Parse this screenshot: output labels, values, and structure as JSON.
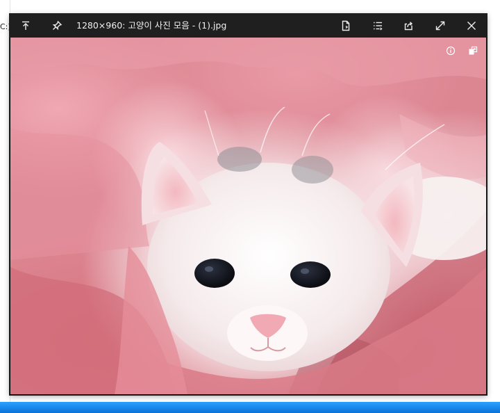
{
  "background": {
    "drive_fragment": "C:)"
  },
  "viewer": {
    "title": "1280×960: 고양이 사진 모음 - (1).jpg",
    "toolbar_left": [
      {
        "icon": "scroll-to-top-icon"
      },
      {
        "icon": "pin-icon"
      }
    ],
    "toolbar_right": [
      {
        "icon": "open-file-icon"
      },
      {
        "icon": "list-icon"
      },
      {
        "icon": "share-icon"
      },
      {
        "icon": "fullscreen-icon"
      },
      {
        "icon": "close-icon"
      }
    ],
    "overlay_buttons": [
      {
        "icon": "info-icon"
      },
      {
        "icon": "copy-icon"
      }
    ]
  },
  "photo": {
    "subject": "white kitten wrapped in a pink fluffy towel",
    "colors": {
      "towel": "#dc8692",
      "towel_dark": "#c05a67",
      "fur": "#fbf3f3",
      "eyes": "#15161c",
      "nose": "#f0a7b2"
    }
  },
  "taskbar": {
    "color": "#0a72d8"
  }
}
